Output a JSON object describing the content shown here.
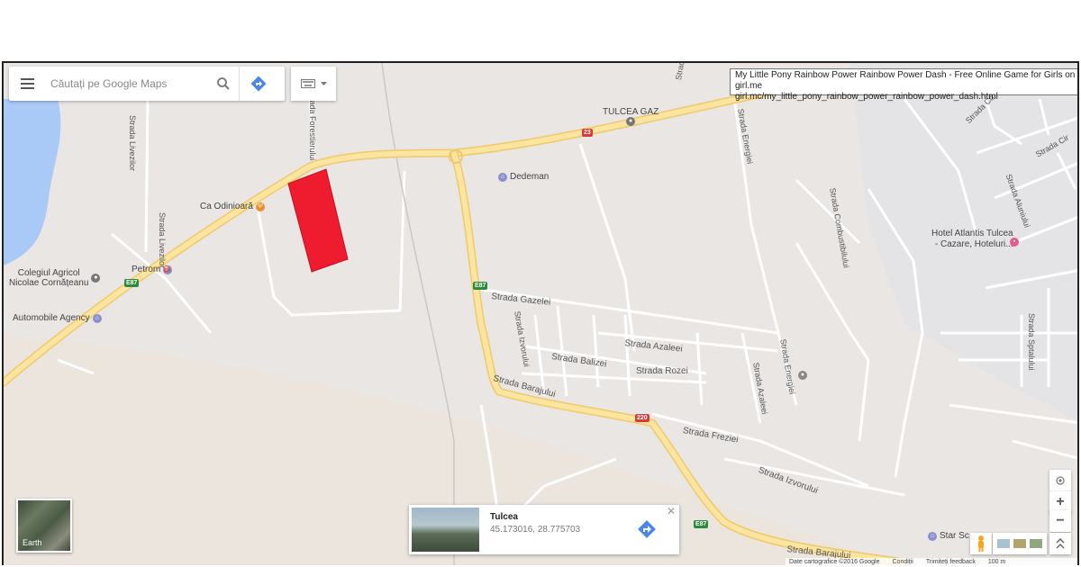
{
  "search": {
    "placeholder": "Căutați pe Google Maps"
  },
  "tooltip": {
    "title": "My Little Pony Rainbow Power Rainbow Power Dash - Free Online Game for Girls on girl.me",
    "url": "girl.mc/my_little_pony_rainbow_power_rainbow_power_dash.html"
  },
  "earth": {
    "label": "Earth"
  },
  "place_card": {
    "name": "Tulcea",
    "coords": "45.173016, 28.775703"
  },
  "footer": {
    "attribution": "Date cartografice ©2016 Google",
    "terms": "Condiții",
    "feedback": "Trimiteți feedback",
    "scale": "100 m"
  },
  "map_labels": {
    "tulcea_gaz": "TULCEA GAZ",
    "dedeman": "Dedeman",
    "ca_odinioara": "Ca Odinioară",
    "colegiul_1": "Colegiul Agricol",
    "colegiul_2": "Nicolae Cornățeanu",
    "petrom": "Petrom",
    "automobile": "Automobile Agency",
    "hotel_1": "Hotel Atlantis Tulcea",
    "hotel_2": "- Cazare, Hoteluri...",
    "star": "Star Sc",
    "str_livezilor_top": "Strada Livezilor",
    "str_livezilor": "Strada Livezilor",
    "str_forestierului": "Strada Forestierului",
    "str_prel": "Strada Prel",
    "str_energiei": "Strada Energiei",
    "str_combustibilului": "Strada Combustibilului",
    "str_gazelei": "Strada Gazelei",
    "str_izvorului": "Strada Izvorului",
    "str_azaleei": "Strada Azaleei",
    "str_balizei": "Strada Balizei",
    "str_rozei": "Strada Rozei",
    "str_azaleei_v": "Strada Azaleei",
    "str_energiei_v": "Strada Energiei",
    "str_barajului": "Strada Barajului",
    "str_barajului_2": "Strada Barajului",
    "str_freziei": "Strada Freziei",
    "str_izvorului_2": "Strada Izvorului",
    "str_sptalului": "Strada Sptalului",
    "str_aluniului": "Strada Aluniului",
    "str_co": "Strada Co",
    "str_cir": "Strada Cir"
  },
  "shields": {
    "r23": "23",
    "e87_a": "E87",
    "e87_b": "E87",
    "r220": "220",
    "e87_c": "E87"
  },
  "colors": {
    "map_bg": "#e9e6e4",
    "major_road": "#fbe5a0",
    "road_edge": "#f0c96a",
    "minor_road": "#ffffff",
    "water": "#a9c9f6",
    "marker": "#ee1c2e"
  }
}
